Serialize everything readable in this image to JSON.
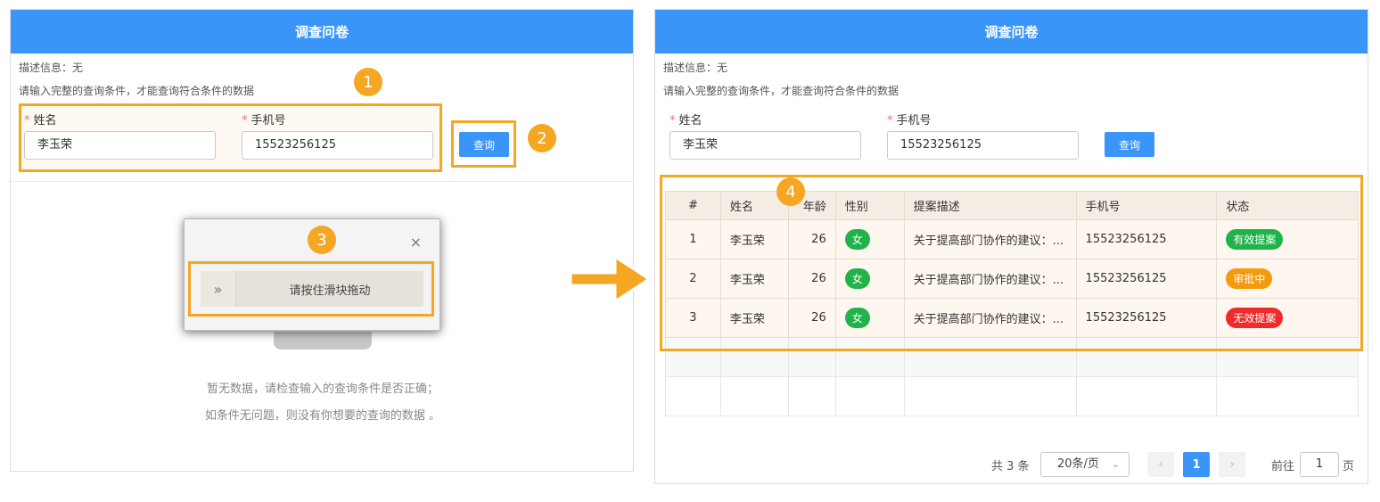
{
  "header_title": "调查问卷",
  "description": "描述信息：无",
  "hint": "请输入完整的查询条件，才能查询符合条件的数据",
  "form": {
    "required_mark": "*",
    "name_label": "姓名",
    "name_value": "李玉荣",
    "phone_label": "手机号",
    "phone_value": "15523256125",
    "query_button": "查询"
  },
  "step_badges": [
    "1",
    "2",
    "3",
    "4"
  ],
  "captcha": {
    "handle_icon": "»",
    "slider_text": "请按住滑块拖动",
    "close_icon": "×"
  },
  "empty_state": {
    "line1": "暂无数据，请检查输入的查询条件是否正确；",
    "line2": "如条件无问题，则没有你想要的查询的数据 。"
  },
  "table": {
    "headers": [
      "#",
      "姓名",
      "年龄",
      "性别",
      "提案描述",
      "手机号",
      "状态"
    ],
    "rows": [
      {
        "num": "1",
        "name": "李玉荣",
        "age": "26",
        "gender": "女",
        "desc": "关于提高部门协作的建议：...",
        "phone": "15523256125",
        "status": "有效提案",
        "status_color": "#1fb34a"
      },
      {
        "num": "2",
        "name": "李玉荣",
        "age": "26",
        "gender": "女",
        "desc": "关于提高部门协作的建议：...",
        "phone": "15523256125",
        "status": "审批中",
        "status_color": "#f59a0c"
      },
      {
        "num": "3",
        "name": "李玉荣",
        "age": "26",
        "gender": "女",
        "desc": "关于提高部门协作的建议：...",
        "phone": "15523256125",
        "status": "无效提案",
        "status_color": "#ef2b2b"
      }
    ],
    "gender_color": "#1fb34a"
  },
  "pagination": {
    "total": "共 3 条",
    "page_size": "20条/页",
    "prev_icon": "‹",
    "current_page": "1",
    "next_icon": "›",
    "goto_label": "前往",
    "goto_value": "1",
    "page_unit": "页"
  },
  "colors": {
    "primary": "#3a95f8",
    "highlight": "#f5a623"
  }
}
